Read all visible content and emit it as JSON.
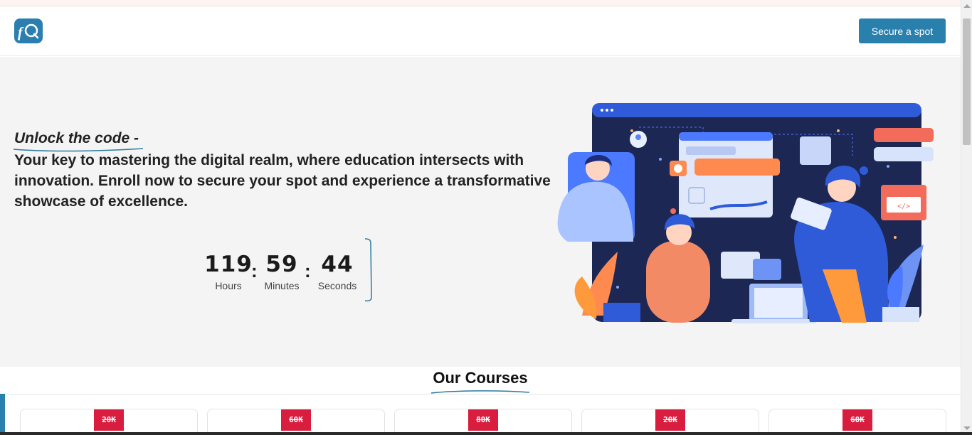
{
  "header": {
    "logo_text": "fC",
    "cta_label": "Secure a spot"
  },
  "hero": {
    "tagline": "Unlock the code -",
    "description": "Your key to mastering the digital realm, where education intersects with innovation. Enroll now to secure your spot and experience a transformative showcase of excellence."
  },
  "countdown": {
    "hours": "119",
    "hours_label": "Hours",
    "minutes": "59",
    "minutes_label": "Minutes",
    "seconds": "44",
    "seconds_label": "Seconds",
    "separator": ":"
  },
  "courses": {
    "title": "Our Courses",
    "cards": [
      {
        "price": "20K"
      },
      {
        "price": "60K"
      },
      {
        "price": "80K"
      },
      {
        "price": "20K"
      },
      {
        "price": "60K"
      }
    ]
  },
  "colors": {
    "accent": "#2a80ad",
    "price_badge": "#d91d3e",
    "hero_bg": "#f4f4f4"
  }
}
